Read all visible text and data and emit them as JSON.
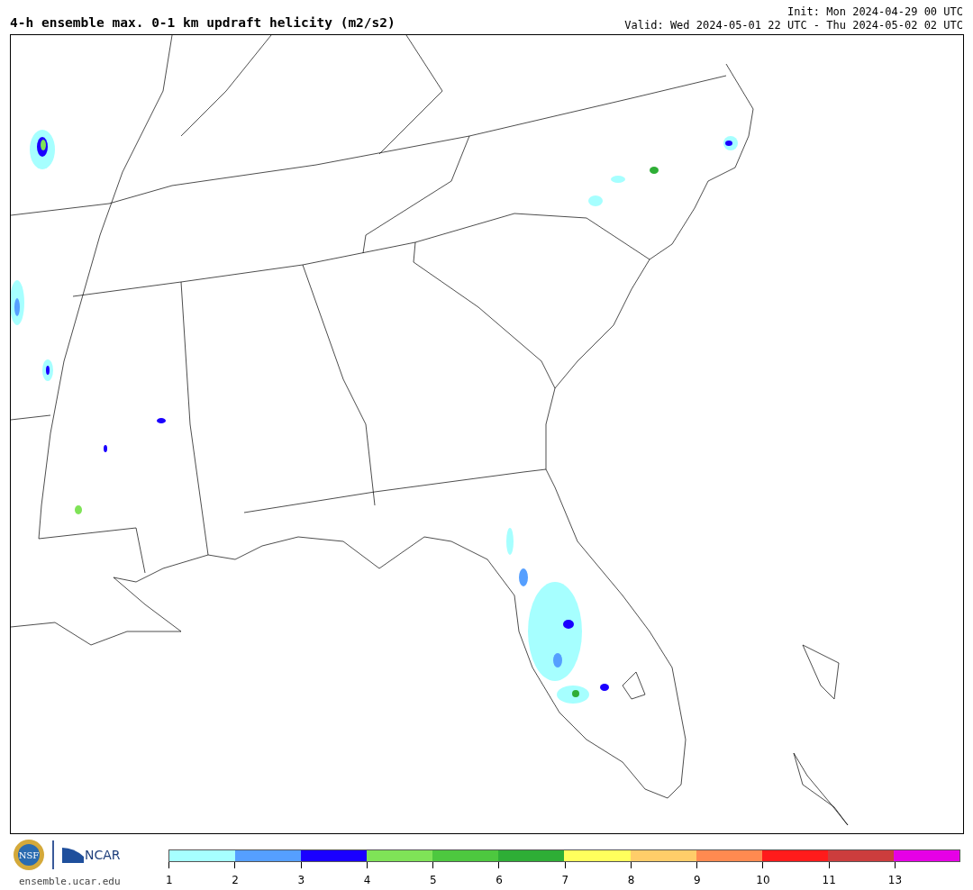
{
  "title": "4-h ensemble max. 0-1 km updraft helicity (m2/s2)",
  "init": "Init: Mon 2024-04-29 00 UTC",
  "valid": "Valid: Wed 2024-05-01 22 UTC - Thu 2024-05-02 02 UTC",
  "logos": {
    "nsf": "NSF",
    "ncar": "NCAR",
    "url": "ensemble.ucar.edu"
  },
  "colorbar": [
    {
      "label": "1",
      "color": "#a6ffff"
    },
    {
      "label": "2",
      "color": "#559fff"
    },
    {
      "label": "3",
      "color": "#1a00ff"
    },
    {
      "label": "4",
      "color": "#7fe357"
    },
    {
      "label": "5",
      "color": "#4dc83f"
    },
    {
      "label": "6",
      "color": "#2eae36"
    },
    {
      "label": "7",
      "color": "#ffff5d"
    },
    {
      "label": "8",
      "color": "#ffcd69"
    },
    {
      "label": "9",
      "color": "#ff8a50"
    },
    {
      "label": "10",
      "color": "#ff1b1b"
    },
    {
      "label": "11",
      "color": "#cc3d3d"
    },
    {
      "label": "13",
      "color": "#e600e6"
    }
  ]
}
